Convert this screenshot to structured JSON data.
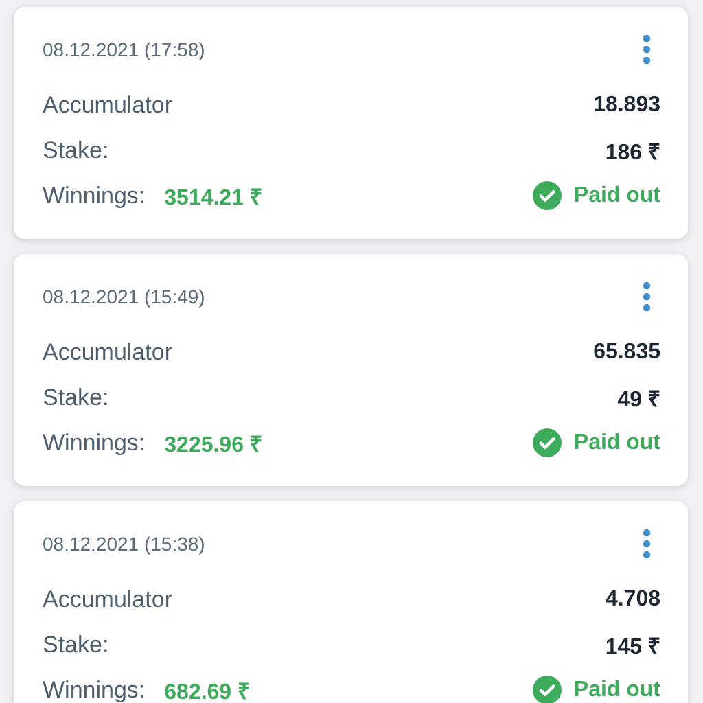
{
  "bets": [
    {
      "date": "08.12.2021 (17:58)",
      "type": "Accumulator",
      "odds": "18.893",
      "stake_label": "Stake:",
      "stake": "186 ₹",
      "winnings_label": "Winnings:",
      "winnings": "3514.21 ₹",
      "status": "Paid out"
    },
    {
      "date": "08.12.2021 (15:49)",
      "type": "Accumulator",
      "odds": "65.835",
      "stake_label": "Stake:",
      "stake": "49 ₹",
      "winnings_label": "Winnings:",
      "winnings": "3225.96 ₹",
      "status": "Paid out"
    },
    {
      "date": "08.12.2021 (15:38)",
      "type": "Accumulator",
      "odds": "4.708",
      "stake_label": "Stake:",
      "stake": "145 ₹",
      "winnings_label": "Winnings:",
      "winnings": "682.69 ₹",
      "status": "Paid out"
    }
  ]
}
